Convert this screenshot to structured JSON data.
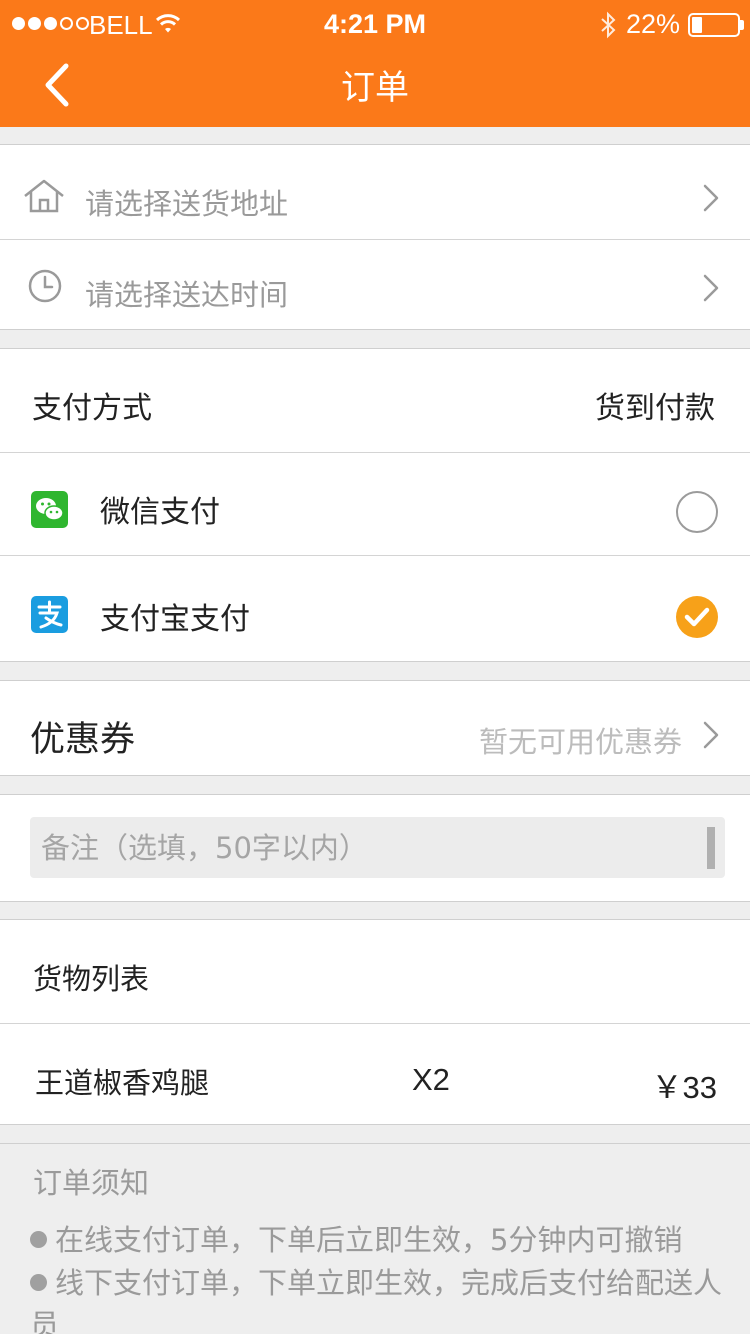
{
  "status_bar": {
    "carrier": "BELL",
    "time": "4:21 PM",
    "battery_percent": "22%",
    "battery_level": 0.22,
    "signal_bars_filled": 3,
    "signal_bars_total": 5,
    "icons": [
      "wifi-icon",
      "bluetooth-icon",
      "battery-icon"
    ]
  },
  "header": {
    "title": "订单",
    "back_icon": "chevron-left-icon"
  },
  "delivery": {
    "address_placeholder": "请选择送货地址",
    "address_icon": "home-icon",
    "time_placeholder": "请选择送达时间",
    "time_icon": "clock-icon"
  },
  "payment": {
    "title": "支付方式",
    "value": "货到付款",
    "options": [
      {
        "label": "微信支付",
        "icon": "wechat-icon",
        "checked": false
      },
      {
        "label": "支付宝支付",
        "icon": "alipay-icon",
        "checked": true
      }
    ]
  },
  "coupon": {
    "title": "优惠券",
    "value": "暂无可用优惠券"
  },
  "note": {
    "placeholder": "备注（选填，50字以内）",
    "value": ""
  },
  "goods": {
    "title": "货物列表",
    "items": [
      {
        "name": "王道椒香鸡腿",
        "quantity": "X2",
        "price": "￥33"
      }
    ]
  },
  "notice": {
    "title": "订单须知",
    "items": [
      "在线支付订单，下单后立即生效，5分钟内可撤销",
      "线下支付订单，下单立即生效，完成后支付给配送人员"
    ]
  },
  "colors": {
    "brand": "#fb7919",
    "checked": "#f7a119",
    "wechat": "#2fb62f",
    "alipay": "#1a9de0"
  }
}
